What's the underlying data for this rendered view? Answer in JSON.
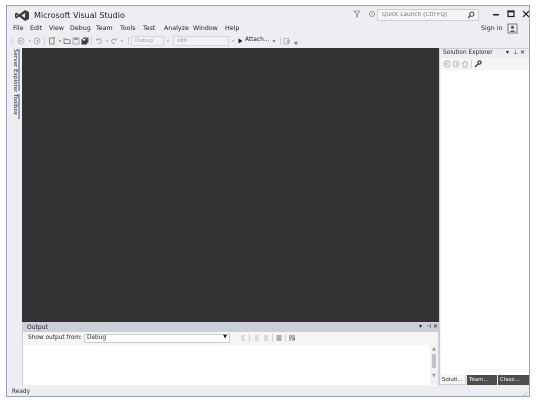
{
  "title_bar": {
    "app_title": "Microsoft Visual Studio",
    "quick_launch_placeholder": "Quick Launch (Ctrl+Q)"
  },
  "menu": {
    "items": [
      "File",
      "Edit",
      "View",
      "Debug",
      "Team",
      "Tools",
      "Test",
      "Analyze",
      "Window",
      "Help"
    ],
    "sign_in": "Sign in"
  },
  "toolbar": {
    "config_combo": "Debug",
    "platform_combo": "x86",
    "attach_label": "Attach..."
  },
  "side_tabs": [
    "Server Explorer",
    "Toolbox"
  ],
  "output_panel": {
    "title": "Output",
    "show_output_label": "Show output from:",
    "source_selected": "Debug"
  },
  "solution_explorer": {
    "title": "Solution Explorer"
  },
  "bottom_tabs": [
    "Soluti...",
    "Team...",
    "Class..."
  ],
  "status_bar": {
    "text": "Ready"
  },
  "colors": {
    "editor_background": "#323234",
    "chrome": "#eeeef2",
    "vs_purple": "#68217a"
  }
}
